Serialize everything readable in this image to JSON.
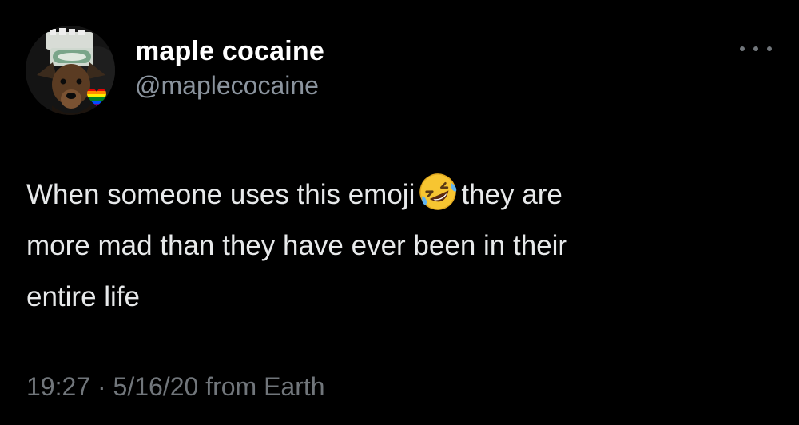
{
  "tweet": {
    "author": {
      "display_name": "maple cocaine",
      "handle": "@maplecocaine",
      "avatar_icon": "dog-avatar",
      "badge_icon": "rainbow-heart-icon"
    },
    "more_icon": "more-options-icon",
    "text": {
      "line1_before": "When someone uses this emoji",
      "emoji_icon": "rolling-on-floor-laughing-emoji",
      "line1_after": "they are",
      "line2": "more mad than they have ever been in their",
      "line3": "entire life"
    },
    "meta": {
      "time": "19:27",
      "separator": "·",
      "date": "5/16/20",
      "source": "from Earth"
    }
  },
  "colors": {
    "background": "#000000",
    "primary_text": "#e7e9ea",
    "secondary_text": "#71767b",
    "display_name": "#ffffff"
  }
}
